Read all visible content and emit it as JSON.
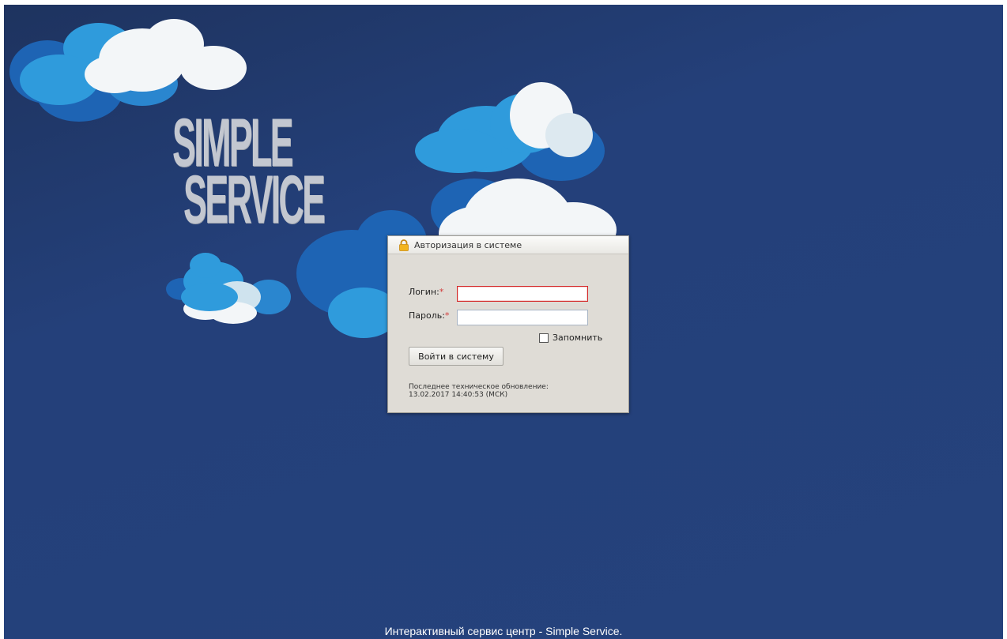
{
  "logo": {
    "line1": "SIMPLE",
    "line2": "SERVICE"
  },
  "dialog": {
    "title": "Авторизация в системе",
    "login_label": "Логин:",
    "password_label": "Пароль:",
    "required_mark": "*",
    "login_value": "",
    "password_value": "",
    "remember_label": "Запомнить",
    "remember_checked": false,
    "submit_label": "Войти в систему",
    "update_label": "Последнее техническое обновление:",
    "update_value": "13.02.2017 14:40:53 (МСК)"
  },
  "footer": {
    "text": "Интерактивный сервис центр - Simple Service."
  },
  "colors": {
    "background": "#25427c",
    "cloud_dark": "#1e64b4",
    "cloud_mid": "#2f9bdc",
    "cloud_light": "#f3f6f8",
    "dialog_bg": "#dfdcd6",
    "active_input_border": "#d42a2a",
    "required_mark": "#d23b3b"
  },
  "icons": {
    "title_icon": "lock-icon"
  }
}
